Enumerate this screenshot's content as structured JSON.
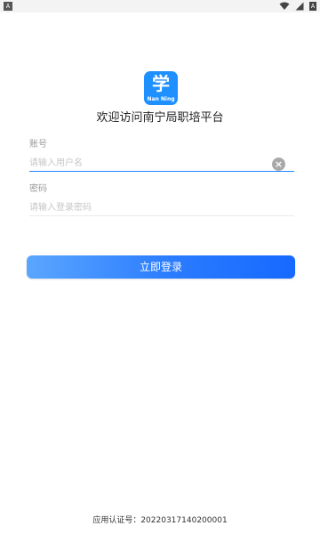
{
  "status_bar": {
    "left_badge": "A",
    "right_badge": "A"
  },
  "logo": {
    "glyph": "学",
    "text": "Nan Ning"
  },
  "welcome_text": "欢迎访问南宁局职培平台",
  "form": {
    "account": {
      "label": "账号",
      "placeholder": "请输入用户名",
      "value": ""
    },
    "password": {
      "label": "密码",
      "placeholder": "请输入登录密码",
      "value": ""
    }
  },
  "clear_icon": "×",
  "login_button": "立即登录",
  "footer": {
    "cert_label": "应用认证号：",
    "cert_value": "20220317140200001"
  },
  "colors": {
    "accent": "#1e7dff",
    "logo_bg": "#1e90ff",
    "underline_active": "#1f86ff",
    "underline_inactive": "#eaeaea",
    "status_bar_bg": "#f3f3f3"
  }
}
